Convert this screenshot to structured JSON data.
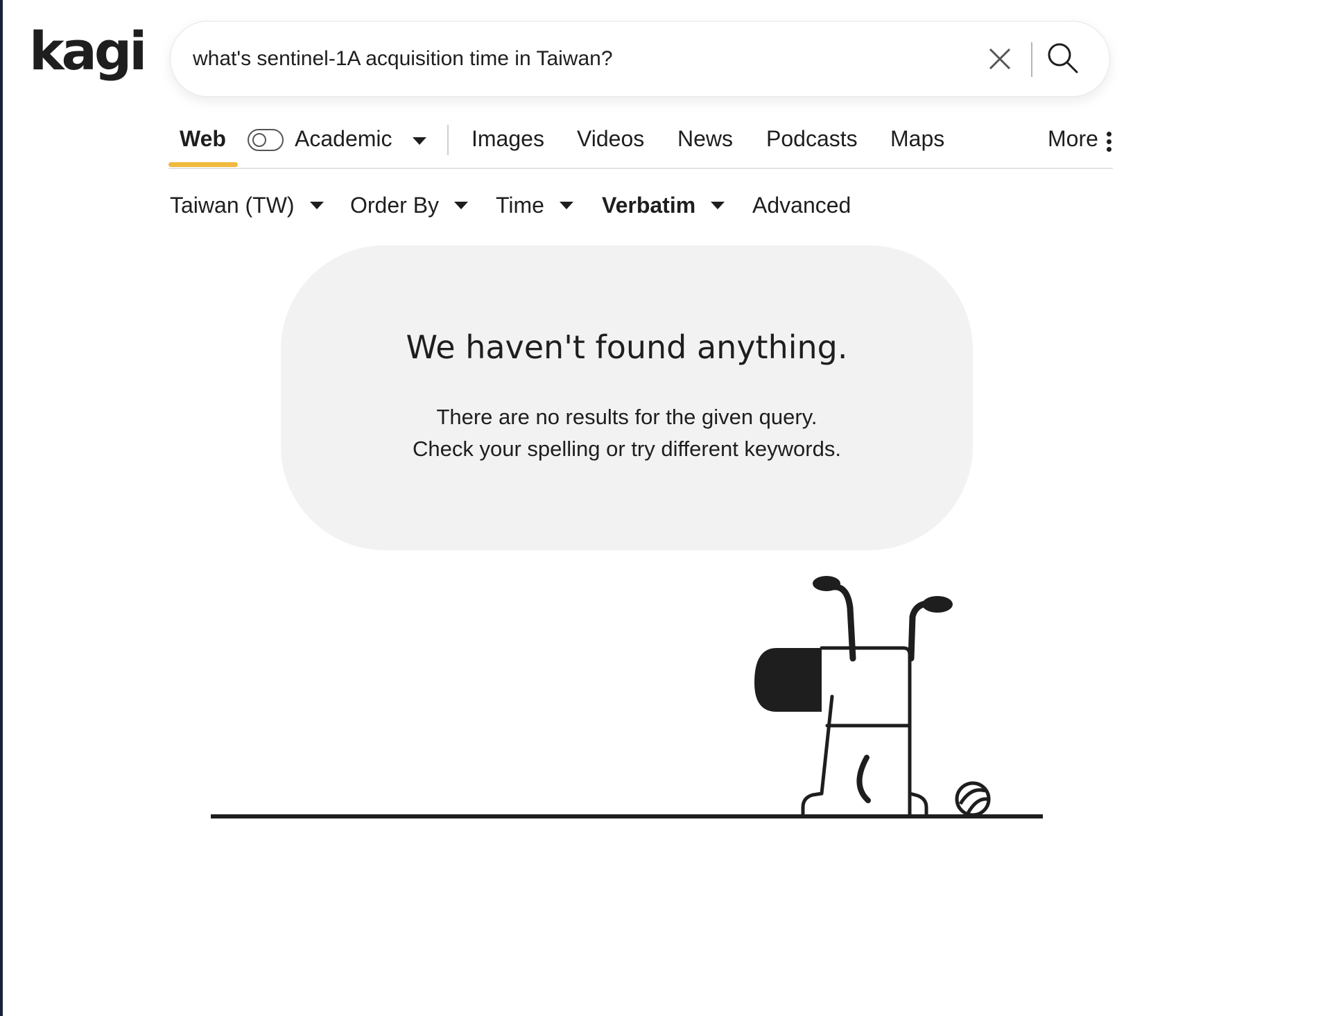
{
  "brand": {
    "logo_text": "kagi",
    "accent_color": "#f1b93d"
  },
  "search": {
    "query": "what's sentinel-1A acquisition time in Taiwan?",
    "clear_icon": "close-icon",
    "submit_icon": "search-icon"
  },
  "tabs": {
    "web": "Web",
    "academic": "Academic",
    "images": "Images",
    "videos": "Videos",
    "news": "News",
    "podcasts": "Podcasts",
    "maps": "Maps",
    "more": "More",
    "active": "Web"
  },
  "filters": {
    "region": "Taiwan (TW)",
    "order_by": "Order By",
    "time": "Time",
    "verbatim": "Verbatim",
    "advanced": "Advanced"
  },
  "empty_state": {
    "title": "We haven't found anything.",
    "line1": "There are no results for the given query.",
    "line2": "Check your spelling or try different keywords."
  }
}
